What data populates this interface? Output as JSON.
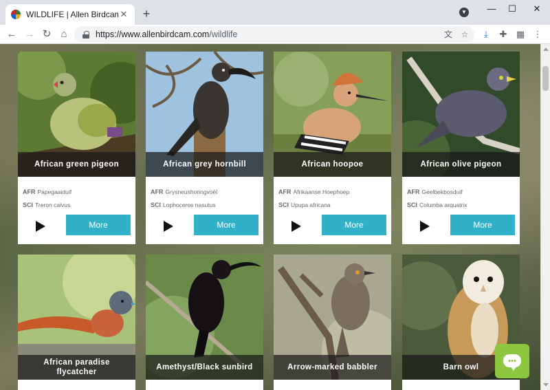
{
  "browser": {
    "tab_title": "WILDLIFE | Allen Birdcam",
    "tab_close": "✕",
    "new_tab": "+",
    "url_host": "https://www.allenbirdcam.com",
    "url_path": "/wildlife",
    "window": {
      "minimize": "—",
      "maximize": "☐",
      "close": "✕"
    }
  },
  "labels": {
    "afr": "AFR",
    "sci": "SCI",
    "more": "More"
  },
  "birds": [
    {
      "name": "African green pigeon",
      "afr": "Papegaaiduif",
      "sci": "Treron calvus"
    },
    {
      "name": "African grey hornbill",
      "afr": "Grysneushoringvoël",
      "sci": "Lophoceros nasutus"
    },
    {
      "name": "African hoopoe",
      "afr": "Afrikaanse Hoephoep",
      "sci": "Upupa africana"
    },
    {
      "name": "African olive pigeon",
      "afr": "Geelbekbosduif",
      "sci": "Columba arquatrix"
    },
    {
      "name": "African paradise flycatcher",
      "afr": "",
      "sci": ""
    },
    {
      "name": "Amethyst/Black sunbird",
      "afr": "",
      "sci": ""
    },
    {
      "name": "Arrow-marked babbler",
      "afr": "",
      "sci": ""
    },
    {
      "name": "Barn owl",
      "afr": "",
      "sci": ""
    }
  ],
  "icons": {
    "back": "back-arrow-icon",
    "forward": "forward-arrow-icon",
    "reload": "reload-icon",
    "home": "home-icon",
    "lock": "lock-icon",
    "translate": "translate-icon",
    "star": "star-icon",
    "download": "download-icon",
    "extensions": "puzzle-icon",
    "menu": "kebab-menu-icon",
    "chat": "chat-bubble-icon"
  },
  "colors": {
    "more_button": "#31b1c8",
    "chat_button": "#8dc63f",
    "caption_bg": "#191919"
  }
}
